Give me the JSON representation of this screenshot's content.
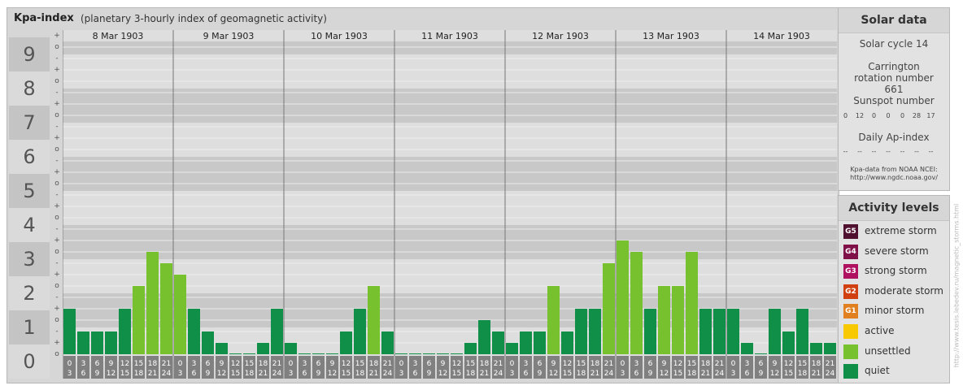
{
  "header": {
    "title": "Kpa-index",
    "subtitle": "(planetary 3-hourly index of geomagnetic activity)"
  },
  "y_axis": {
    "labels": [
      "0",
      "1",
      "2",
      "3",
      "4",
      "5",
      "6",
      "7",
      "8",
      "9"
    ],
    "sub_ticks": [
      "o",
      "-",
      "+"
    ]
  },
  "chart_data": {
    "type": "bar",
    "ylim": [
      0,
      9
    ],
    "days": [
      "8 Mar 1903",
      "9 Mar 1903",
      "10 Mar 1903",
      "11 Mar 1903",
      "12 Mar 1903",
      "13 Mar 1903",
      "14 Mar 1903"
    ],
    "interval_tops": [
      "0",
      "3",
      "6",
      "9",
      "12",
      "15",
      "18",
      "21"
    ],
    "interval_bottoms": [
      "3",
      "6",
      "9",
      "12",
      "15",
      "18",
      "21",
      "24"
    ],
    "series": [
      {
        "values": [
          1.333,
          0.667,
          0.667,
          0.667,
          1.333,
          2.0,
          3.0,
          2.667,
          2.333,
          1.333,
          0.667,
          0.333,
          0.0,
          0.0,
          0.333,
          1.333,
          0.333,
          0.0,
          0.0,
          0.0,
          0.667,
          1.333,
          2.0,
          0.667,
          0.0,
          0.0,
          0.0,
          0.0,
          0.0,
          0.333,
          1.0,
          0.667,
          0.333,
          0.667,
          0.667,
          2.0,
          0.667,
          1.333,
          1.333,
          2.667,
          3.333,
          3.0,
          1.333,
          2.0,
          2.0,
          3.0,
          1.333,
          1.333,
          1.333,
          0.333,
          0.0,
          1.333,
          0.667,
          1.333,
          0.333,
          0.333
        ]
      }
    ],
    "activity_colors": {
      "quiet": "#0f8f48",
      "unsettled": "#76c12d",
      "active": "#f8c800",
      "G1": "#e08020",
      "G2": "#d04010",
      "G3": "#b01060",
      "G4": "#801048",
      "G5": "#501030"
    }
  },
  "solar": {
    "title": "Solar data",
    "cycle": "Solar cycle 14",
    "carrington": "Carrington rotation number 661",
    "sunspot_label": "Sunspot number",
    "sunspot_values": [
      "0",
      "12",
      "0",
      "0",
      "0",
      "28",
      "17"
    ],
    "ap_label": "Daily Ap-index",
    "ap_values": [
      "--",
      "--",
      "--",
      "--",
      "--",
      "--",
      "--"
    ],
    "source_line1": "Kpa-data from NOAA NCEI:",
    "source_line2": "http://www.ngdc.noaa.gov/"
  },
  "activity": {
    "title": "Activity levels",
    "items": [
      {
        "badge": "G5",
        "label": "extreme storm",
        "color": "#501030"
      },
      {
        "badge": "G4",
        "label": "severe storm",
        "color": "#801048"
      },
      {
        "badge": "G3",
        "label": "strong storm",
        "color": "#b01060"
      },
      {
        "badge": "G2",
        "label": "moderate storm",
        "color": "#d04010"
      },
      {
        "badge": "G1",
        "label": "minor storm",
        "color": "#e08020"
      },
      {
        "badge": "",
        "label": "active",
        "color": "#f8c800"
      },
      {
        "badge": "",
        "label": "unsettled",
        "color": "#76c12d"
      },
      {
        "badge": "",
        "label": "quiet",
        "color": "#0f8f48"
      }
    ]
  },
  "credit": "http://www.tesis.lebedev.ru/magnetic_storms.html"
}
